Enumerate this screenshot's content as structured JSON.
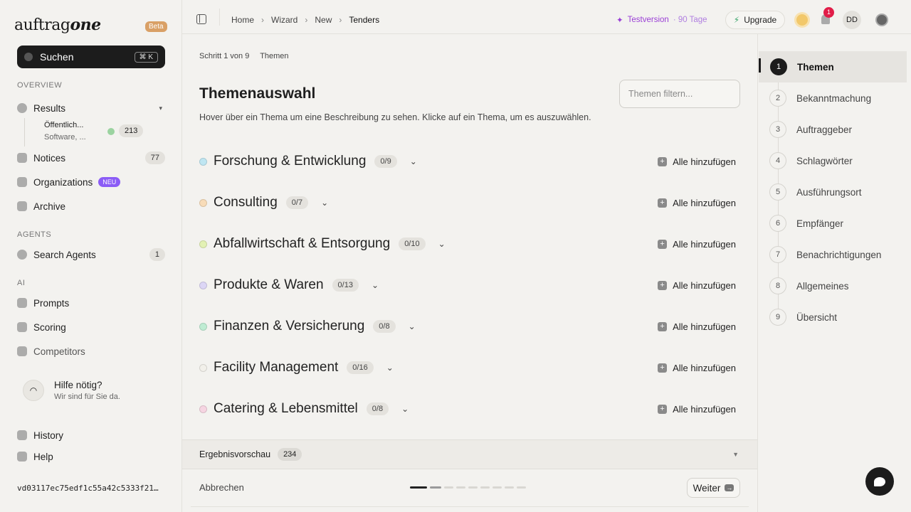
{
  "brand": {
    "logo_a": "auftrag",
    "logo_b": "one",
    "beta": "Beta"
  },
  "search": {
    "label": "Suchen",
    "shortcut": "⌘ K"
  },
  "sidebar": {
    "overview_label": "OVERVIEW",
    "results": {
      "label": "Results",
      "sub_title": "Öffentlich...",
      "sub_detail": "Software, ...",
      "sub_count": "213"
    },
    "notices": {
      "label": "Notices",
      "count": "77"
    },
    "organizations": {
      "label": "Organizations",
      "badge": "NEU"
    },
    "archive": {
      "label": "Archive"
    },
    "agents_label": "AGENTS",
    "search_agents": {
      "label": "Search Agents",
      "count": "1"
    },
    "ai_label": "AI",
    "prompts": {
      "label": "Prompts"
    },
    "scoring": {
      "label": "Scoring"
    },
    "competitors": {
      "label": "Competitors"
    },
    "help_title": "Hilfe nötig?",
    "help_sub": "Wir sind für Sie da.",
    "history": {
      "label": "History"
    },
    "help": {
      "label": "Help"
    },
    "hash": "vd03117ec75edf1c55a42c5333f21…"
  },
  "topbar": {
    "breadcrumbs": [
      "Home",
      "Wizard",
      "New",
      "Tenders"
    ],
    "trial_label": "Testversion",
    "trial_days": "· 90 Tage",
    "upgrade": "Upgrade",
    "notif_count": "1",
    "avatar": "DD"
  },
  "main": {
    "step_label": "Schritt 1 von 9",
    "step_name": "Themen",
    "title": "Themenauswahl",
    "description": "Hover über ein Thema um eine Beschreibung zu sehen. Klicke auf ein Thema, um es auszuwählen.",
    "filter_placeholder": "Themen filtern...",
    "add_all": "Alle hinzufügen",
    "topics": [
      {
        "name": "Forschung & Entwicklung",
        "count": "0/9",
        "color": "#bfe6f2"
      },
      {
        "name": "Consulting",
        "count": "0/7",
        "color": "#f8dcb8"
      },
      {
        "name": "Abfallwirtschaft & Entsorgung",
        "count": "0/10",
        "color": "#e3f1b4"
      },
      {
        "name": "Produkte & Waren",
        "count": "0/13",
        "color": "#dcd6f5"
      },
      {
        "name": "Finanzen & Versicherung",
        "count": "0/8",
        "color": "#bfecd3"
      },
      {
        "name": "Facility Management",
        "count": "0/16",
        "color": "#f2f0ea"
      },
      {
        "name": "Catering & Lebensmittel",
        "count": "0/8",
        "color": "#f6d5e2"
      }
    ],
    "preview_label": "Ergebnisvorschau",
    "preview_count": "234",
    "cancel": "Abbrechen",
    "next": "Weiter"
  },
  "rail": {
    "steps": [
      {
        "num": "1",
        "label": "Themen"
      },
      {
        "num": "2",
        "label": "Bekanntmachung"
      },
      {
        "num": "3",
        "label": "Auftraggeber"
      },
      {
        "num": "4",
        "label": "Schlagwörter"
      },
      {
        "num": "5",
        "label": "Ausführungsort"
      },
      {
        "num": "6",
        "label": "Empfänger"
      },
      {
        "num": "7",
        "label": "Benachrichtigungen"
      },
      {
        "num": "8",
        "label": "Allgemeines"
      },
      {
        "num": "9",
        "label": "Übersicht"
      }
    ],
    "active_step": "1"
  }
}
